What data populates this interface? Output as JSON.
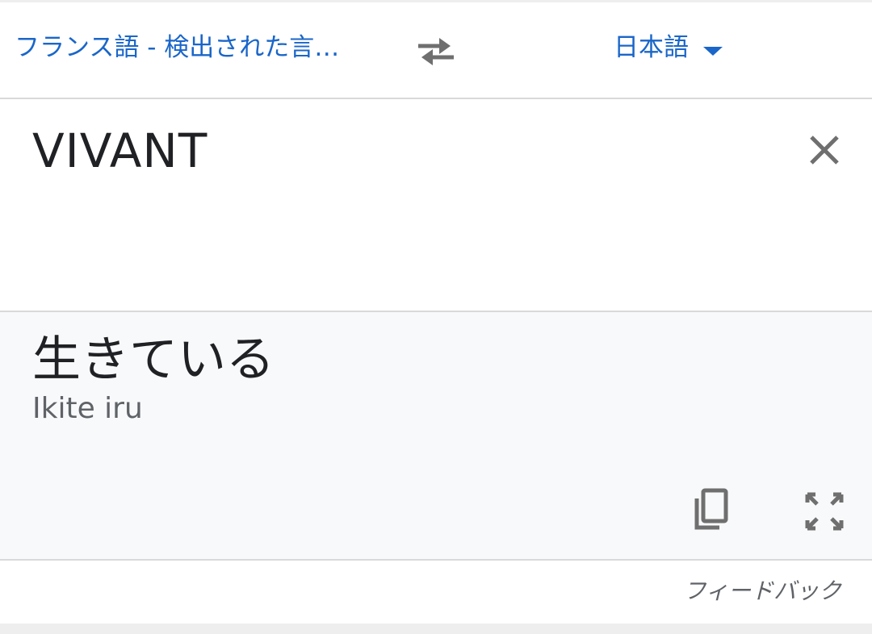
{
  "language_bar": {
    "source_language": "フランス語 - 検出された言…",
    "target_language": "日本語"
  },
  "input": {
    "text": "VIVANT"
  },
  "output": {
    "translation": "生きている",
    "romanization": "Ikite iru"
  },
  "footer": {
    "feedback_label": "フィードバック"
  },
  "icons": {
    "swap": "swap-horiz-icon",
    "dropdown": "arrow-drop-down-icon",
    "clear": "close-icon",
    "copy": "copy-icon",
    "fullscreen": "fullscreen-icon"
  },
  "colors": {
    "accent": "#1a66c9",
    "text_primary": "#202124",
    "text_secondary": "#5f6368",
    "icon_gray": "#6f6f6f",
    "output_background": "#f8f9fa"
  }
}
